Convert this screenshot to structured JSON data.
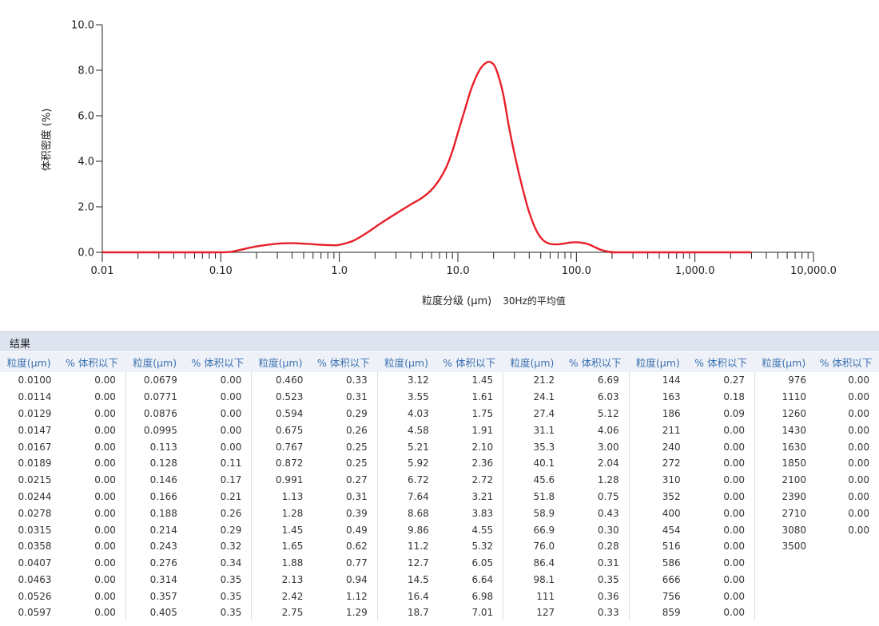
{
  "chart_data": {
    "type": "line",
    "xscale": "log",
    "ylabel": "体积密度 (%)",
    "xlabel": "粒度分级 (μm)",
    "xlabel_note": "30Hz的平均值",
    "ylim": [
      0,
      10
    ],
    "xlim": [
      0.01,
      10000
    ],
    "y_ticks": [
      {
        "v": 0,
        "label": "0.0"
      },
      {
        "v": 2,
        "label": "2.0"
      },
      {
        "v": 4,
        "label": "4.0"
      },
      {
        "v": 6,
        "label": "6.0"
      },
      {
        "v": 8,
        "label": "8.0"
      },
      {
        "v": 10,
        "label": "10.0"
      }
    ],
    "x_ticks": [
      {
        "v": 0.01,
        "label": "0.01"
      },
      {
        "v": 0.1,
        "label": "0.10"
      },
      {
        "v": 1,
        "label": "1.0"
      },
      {
        "v": 10,
        "label": "10.0"
      },
      {
        "v": 100,
        "label": "100.0"
      },
      {
        "v": 1000,
        "label": "1,000.0"
      },
      {
        "v": 10000,
        "label": "10,000.0"
      }
    ],
    "line_color": "#e8202a",
    "series": [
      {
        "x": [
          0.01,
          0.02,
          0.05,
          0.1,
          0.12,
          0.15,
          0.2,
          0.3,
          0.4,
          0.5,
          0.7,
          0.9,
          1.0,
          1.3,
          1.7,
          2.2,
          3.0,
          4.0,
          5.0,
          6.0,
          7.0,
          8.0,
          9.0,
          10.0,
          11.5,
          13.0,
          15.0,
          17.0,
          19.0,
          21.0,
          24.0,
          27.0,
          31.0,
          35.0,
          40.0,
          46.0,
          52.0,
          59.0,
          67.0,
          76.0,
          86.0,
          98.0,
          111.0,
          127.0,
          144.0,
          163.0,
          186.0,
          211.0,
          240.0,
          3000.0
        ],
        "y": [
          0.0,
          0.0,
          0.0,
          0.0,
          0.02,
          0.12,
          0.26,
          0.38,
          0.4,
          0.38,
          0.33,
          0.31,
          0.33,
          0.5,
          0.85,
          1.25,
          1.7,
          2.1,
          2.4,
          2.75,
          3.2,
          3.75,
          4.45,
          5.25,
          6.3,
          7.2,
          7.95,
          8.3,
          8.35,
          8.05,
          7.0,
          5.5,
          4.0,
          2.85,
          1.75,
          0.95,
          0.55,
          0.38,
          0.35,
          0.37,
          0.42,
          0.44,
          0.42,
          0.35,
          0.22,
          0.1,
          0.03,
          0.0,
          0.0,
          0.0
        ]
      }
    ]
  },
  "results": {
    "title": "结果",
    "headers": {
      "size": "粒度(μm)",
      "pct": "% 体积以下"
    },
    "columns": [
      {
        "sizes": [
          "0.0100",
          "0.0114",
          "0.0129",
          "0.0147",
          "0.0167",
          "0.0189",
          "0.0215",
          "0.0244",
          "0.0278",
          "0.0315",
          "0.0358",
          "0.0407",
          "0.0463",
          "0.0526",
          "0.0597"
        ],
        "pcts": [
          "0.00",
          "0.00",
          "0.00",
          "0.00",
          "0.00",
          "0.00",
          "0.00",
          "0.00",
          "0.00",
          "0.00",
          "0.00",
          "0.00",
          "0.00",
          "0.00",
          "0.00"
        ]
      },
      {
        "sizes": [
          "0.0679",
          "0.0771",
          "0.0876",
          "0.0995",
          "0.113",
          "0.128",
          "0.146",
          "0.166",
          "0.188",
          "0.214",
          "0.243",
          "0.276",
          "0.314",
          "0.357",
          "0.405"
        ],
        "pcts": [
          "0.00",
          "0.00",
          "0.00",
          "0.00",
          "0.00",
          "0.11",
          "0.17",
          "0.21",
          "0.26",
          "0.29",
          "0.32",
          "0.34",
          "0.35",
          "0.35",
          "0.35"
        ]
      },
      {
        "sizes": [
          "0.460",
          "0.523",
          "0.594",
          "0.675",
          "0.767",
          "0.872",
          "0.991",
          "1.13",
          "1.28",
          "1.45",
          "1.65",
          "1.88",
          "2.13",
          "2.42",
          "2.75"
        ],
        "pcts": [
          "0.33",
          "0.31",
          "0.29",
          "0.26",
          "0.25",
          "0.25",
          "0.27",
          "0.31",
          "0.39",
          "0.49",
          "0.62",
          "0.77",
          "0.94",
          "1.12",
          "1.29"
        ]
      },
      {
        "sizes": [
          "3.12",
          "3.55",
          "4.03",
          "4.58",
          "5.21",
          "5.92",
          "6.72",
          "7.64",
          "8.68",
          "9.86",
          "11.2",
          "12.7",
          "14.5",
          "16.4",
          "18.7"
        ],
        "pcts": [
          "1.45",
          "1.61",
          "1.75",
          "1.91",
          "2.10",
          "2.36",
          "2.72",
          "3.21",
          "3.83",
          "4.55",
          "5.32",
          "6.05",
          "6.64",
          "6.98",
          "7.01"
        ]
      },
      {
        "sizes": [
          "21.2",
          "24.1",
          "27.4",
          "31.1",
          "35.3",
          "40.1",
          "45.6",
          "51.8",
          "58.9",
          "66.9",
          "76.0",
          "86.4",
          "98.1",
          "111",
          "127"
        ],
        "pcts": [
          "6.69",
          "6.03",
          "5.12",
          "4.06",
          "3.00",
          "2.04",
          "1.28",
          "0.75",
          "0.43",
          "0.30",
          "0.28",
          "0.31",
          "0.35",
          "0.36",
          "0.33"
        ]
      },
      {
        "sizes": [
          "144",
          "163",
          "186",
          "211",
          "240",
          "272",
          "310",
          "352",
          "400",
          "454",
          "516",
          "586",
          "666",
          "756",
          "859"
        ],
        "pcts": [
          "0.27",
          "0.18",
          "0.09",
          "0.00",
          "0.00",
          "0.00",
          "0.00",
          "0.00",
          "0.00",
          "0.00",
          "0.00",
          "0.00",
          "0.00",
          "0.00",
          "0.00"
        ]
      },
      {
        "sizes": [
          "976",
          "1110",
          "1260",
          "1430",
          "1630",
          "1850",
          "2100",
          "2390",
          "2710",
          "3080",
          "3500",
          "",
          "",
          "",
          ""
        ],
        "pcts": [
          "0.00",
          "0.00",
          "0.00",
          "0.00",
          "0.00",
          "0.00",
          "0.00",
          "0.00",
          "0.00",
          "0.00",
          "",
          "",
          "",
          "",
          ""
        ]
      }
    ]
  }
}
